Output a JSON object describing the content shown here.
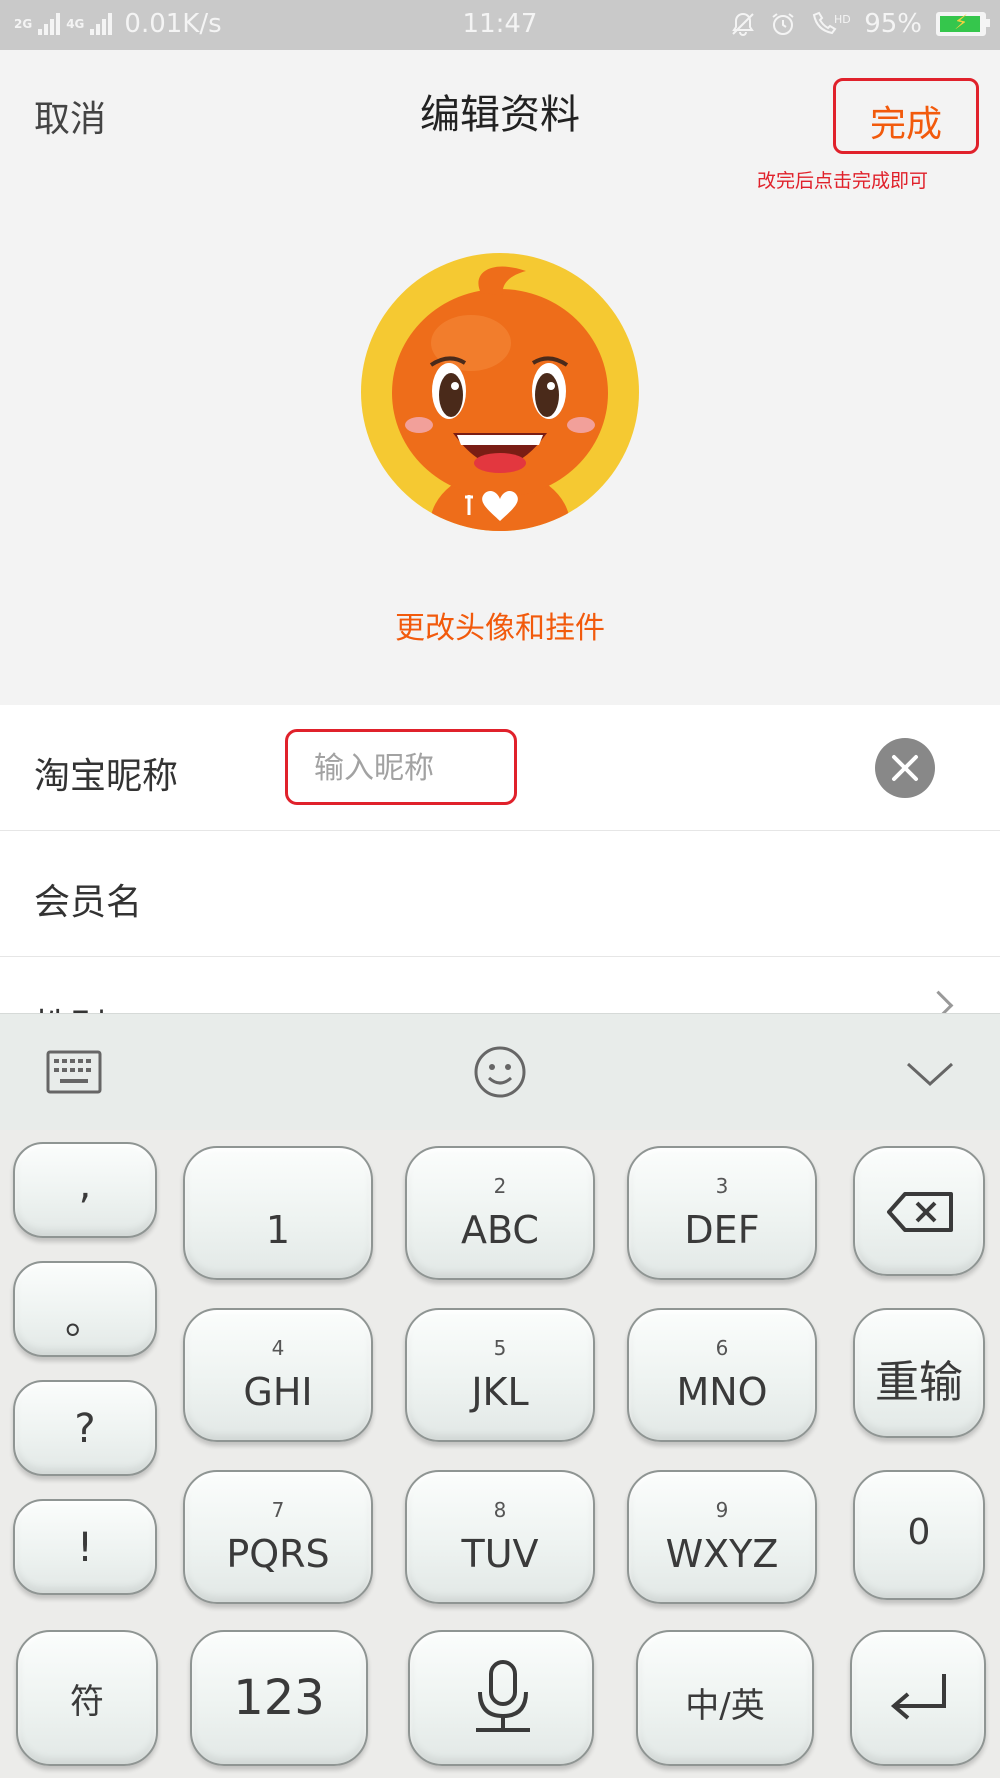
{
  "status_bar": {
    "net1": "2G",
    "net2": "4G",
    "speed": "0.01K/s",
    "time": "11:47",
    "battery_percent": "95%",
    "battery_level": 0.95,
    "icons": [
      "bell-off-icon",
      "alarm-icon",
      "hd-call-icon",
      "battery-charging-icon"
    ]
  },
  "header": {
    "cancel_label": "取消",
    "title": "编辑资料",
    "done_label": "完成",
    "annotation": "改完后点击完成即可"
  },
  "avatar": {
    "change_label": "更改头像和挂件"
  },
  "form": {
    "nickname_label": "淘宝昵称",
    "nickname_placeholder": "输入昵称",
    "member_label": "会员名",
    "gender_label": "性别"
  },
  "keyboard": {
    "toolbar_icons": [
      "keyboard-icon",
      "emoji-icon",
      "collapse-icon"
    ],
    "punct": [
      ",",
      "。",
      "?",
      "!"
    ],
    "keys": [
      {
        "num": "",
        "letters": "1"
      },
      {
        "num": "2",
        "letters": "ABC"
      },
      {
        "num": "3",
        "letters": "DEF"
      },
      {
        "num": "4",
        "letters": "GHI"
      },
      {
        "num": "5",
        "letters": "JKL"
      },
      {
        "num": "6",
        "letters": "MNO"
      },
      {
        "num": "7",
        "letters": "PQRS"
      },
      {
        "num": "8",
        "letters": "TUV"
      },
      {
        "num": "9",
        "letters": "WXYZ"
      }
    ],
    "retype_label": "重输",
    "zero_label": "0",
    "symbol_label": "符",
    "num_mode_label": "123",
    "lang_label": "中/英"
  },
  "colors": {
    "accent_orange": "#f25a0c",
    "annotation_red": "#e0212b",
    "status_bar_bg": "#c9c9c9"
  }
}
